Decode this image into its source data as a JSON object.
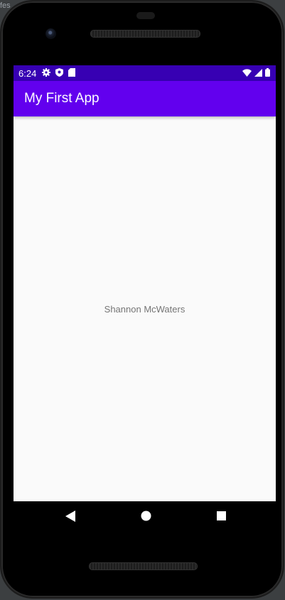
{
  "ide": {
    "text": "fes"
  },
  "status_bar": {
    "time": "6:24",
    "icons_left": [
      "gear-icon",
      "shield-icon",
      "sd-card-icon"
    ],
    "icons_right": [
      "wifi-icon",
      "cell-signal-icon",
      "battery-icon"
    ],
    "color": "#3700b3"
  },
  "app_bar": {
    "title": "My First App",
    "color": "#6200ee"
  },
  "content": {
    "text": "Shannon McWaters"
  },
  "nav_bar": {
    "buttons": [
      "back-icon",
      "home-icon",
      "recents-icon"
    ]
  }
}
